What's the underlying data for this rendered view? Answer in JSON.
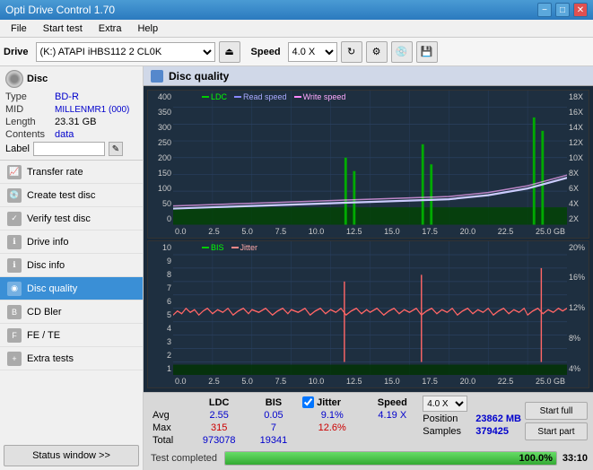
{
  "titleBar": {
    "title": "Opti Drive Control 1.70",
    "minimizeLabel": "−",
    "maximizeLabel": "□",
    "closeLabel": "✕"
  },
  "menuBar": {
    "items": [
      "File",
      "Start test",
      "Extra",
      "Help"
    ]
  },
  "toolbar": {
    "driveLabel": "Drive",
    "driveValue": "(K:) ATAPI iHBS112  2 CL0K",
    "speedLabel": "Speed",
    "speedValue": "4.0 X"
  },
  "disc": {
    "title": "Disc",
    "typeLabel": "Type",
    "typeValue": "BD-R",
    "midLabel": "MID",
    "midValue": "MILLENMR1 (000)",
    "lengthLabel": "Length",
    "lengthValue": "23.31 GB",
    "contentsLabel": "Contents",
    "contentsValue": "data",
    "labelLabel": "Label",
    "labelValue": ""
  },
  "nav": {
    "items": [
      {
        "id": "transfer-rate",
        "label": "Transfer rate",
        "active": false
      },
      {
        "id": "create-test-disc",
        "label": "Create test disc",
        "active": false
      },
      {
        "id": "verify-test-disc",
        "label": "Verify test disc",
        "active": false
      },
      {
        "id": "drive-info",
        "label": "Drive info",
        "active": false
      },
      {
        "id": "disc-info",
        "label": "Disc info",
        "active": false
      },
      {
        "id": "disc-quality",
        "label": "Disc quality",
        "active": true
      },
      {
        "id": "cd-bler",
        "label": "CD Bler",
        "active": false
      },
      {
        "id": "fe-te",
        "label": "FE / TE",
        "active": false
      },
      {
        "id": "extra-tests",
        "label": "Extra tests",
        "active": false
      }
    ],
    "statusBtn": "Status window >>"
  },
  "chartArea": {
    "title": "Disc quality",
    "topChart": {
      "legend": [
        {
          "label": "LDC",
          "color": "#00aa00"
        },
        {
          "label": "Read speed",
          "color": "#8888ff"
        },
        {
          "label": "Write speed",
          "color": "#ff88ff"
        }
      ],
      "yLabels": [
        "400",
        "350",
        "300",
        "250",
        "200",
        "150",
        "100",
        "50",
        "0"
      ],
      "yLabelsRight": [
        "18X",
        "16X",
        "14X",
        "12X",
        "10X",
        "8X",
        "6X",
        "4X",
        "2X"
      ],
      "xLabels": [
        "0.0",
        "2.5",
        "5.0",
        "7.5",
        "10.0",
        "12.5",
        "15.0",
        "17.5",
        "20.0",
        "22.5",
        "25.0 GB"
      ]
    },
    "bottomChart": {
      "legend": [
        {
          "label": "BIS",
          "color": "#00aa00"
        },
        {
          "label": "Jitter",
          "color": "#ff8888"
        }
      ],
      "yLabels": [
        "10",
        "9",
        "8",
        "7",
        "6",
        "5",
        "4",
        "3",
        "2",
        "1"
      ],
      "yLabelsRight": [
        "20%",
        "16%",
        "12%",
        "8%",
        "4%"
      ],
      "xLabels": [
        "0.0",
        "2.5",
        "5.0",
        "7.5",
        "10.0",
        "12.5",
        "15.0",
        "17.5",
        "20.0",
        "22.5",
        "25.0 GB"
      ]
    }
  },
  "stats": {
    "headers": [
      "LDC",
      "BIS",
      "",
      "Jitter",
      "Speed"
    ],
    "avgLabel": "Avg",
    "avgLDC": "2.55",
    "avgBIS": "0.05",
    "avgJitter": "9.1%",
    "avgSpeed": "4.19 X",
    "maxLabel": "Max",
    "maxLDC": "315",
    "maxBIS": "7",
    "maxJitter": "12.6%",
    "totalLabel": "Total",
    "totalLDC": "973078",
    "totalBIS": "19341",
    "positionLabel": "Position",
    "positionValue": "23862 MB",
    "samplesLabel": "Samples",
    "samplesValue": "379425",
    "speedSelectValue": "4.0 X",
    "startFullBtn": "Start full",
    "startPartBtn": "Start part",
    "jitterLabel": "Jitter"
  },
  "statusBar": {
    "statusText": "Test completed",
    "progressValue": 100,
    "progressLabel": "100.0%",
    "timeValue": "33:10"
  }
}
